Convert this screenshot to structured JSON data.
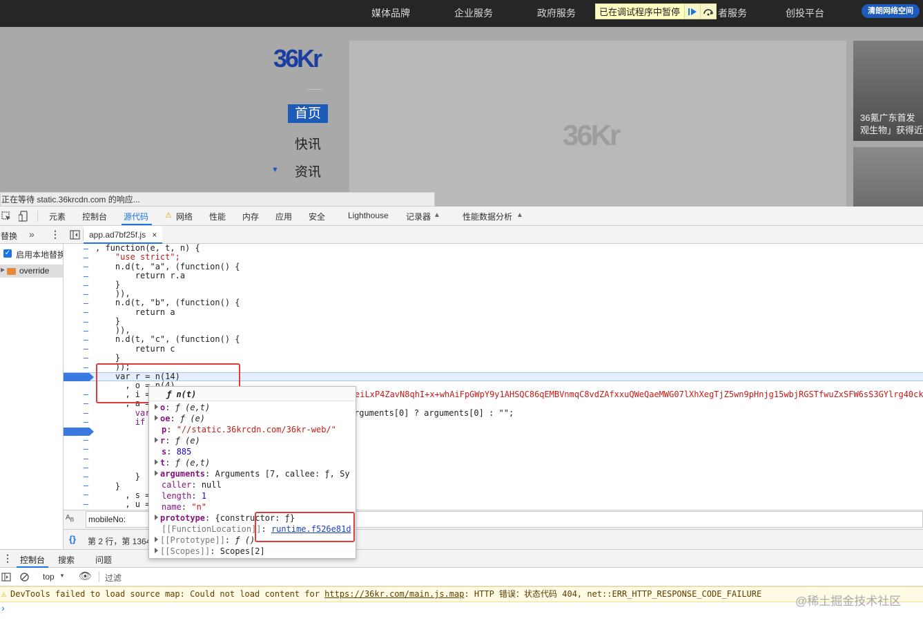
{
  "topnav": {
    "items": [
      "媒体品牌",
      "企业服务",
      "政府服务",
      "者服务",
      "创投平台"
    ],
    "paused_text": "已在调试程序中暂停",
    "brand_button": "清朗网络空间"
  },
  "page": {
    "logo": "36Kr",
    "nav_active": "首页",
    "nav_items": [
      "快讯",
      "资讯"
    ],
    "banner_logo": "36Kr",
    "side_card_lines": [
      "36氪广东首发",
      "观生物」获得近"
    ],
    "status_text": "正在等待 static.36krcdn.com 的响应..."
  },
  "devtools": {
    "tabs": [
      "元素",
      "控制台",
      "源代码",
      "网络",
      "性能",
      "内存",
      "应用",
      "安全",
      "Lighthouse",
      "记录器",
      "性能数据分析"
    ],
    "active_tab": "源代码",
    "left_panel": {
      "tab": "替换",
      "more": "»",
      "enable_label": "启用本地替换",
      "folder": "override"
    },
    "file_tab": "app.ad7bf25f.js",
    "code_lines": [
      ", function(e, t, n) {",
      "    \"use strict\";",
      "    n.d(t, \"a\", (function() {",
      "        return r.a",
      "    }",
      "    )),",
      "    n.d(t, \"b\", (function() {",
      "        return a",
      "    }",
      "    )),",
      "    n.d(t, \"c\", (function() {",
      "        return c",
      "    }",
      "    ));",
      "    var r = n(14)",
      "      , o = n(4)",
      "      , i =",
      "      , a =",
      "        var",
      "        if",
      "",
      "",
      "",
      "",
      "",
      "        }",
      "    }",
      "      , s =",
      "      , u ="
    ],
    "long_line_fragment": "eiLxP4ZavN8qhI+x+whAiFpGWpY9y1AHSQC86qEMBVnmqC8vdZAfxxuQWeQaeMWG07lXhXegTjZ5wn9pHnjg15wbjRGSTfwuZxSFW6sS3GYlrg40ck",
    "args_fragment": "rguments[0] ? arguments[0] : \"\";",
    "search_value": "mobileNo:",
    "status_line": "第 2 行，第 1364",
    "popover": {
      "title": "ƒ n(t)",
      "rows": [
        {
          "expand": true,
          "key": "o",
          "value": "ƒ (e,t)"
        },
        {
          "expand": true,
          "key": "oe",
          "value": "ƒ (e)"
        },
        {
          "expand": false,
          "key": "p",
          "value": "\"//static.36krcdn.com/36kr-web/\""
        },
        {
          "expand": true,
          "key": "r",
          "value": "ƒ (e)"
        },
        {
          "expand": false,
          "key": "s",
          "value": "885"
        },
        {
          "expand": true,
          "key": "t",
          "value": "ƒ (e,t)"
        },
        {
          "expand": true,
          "key": "arguments",
          "value": "Arguments [7, callee: ƒ, Sy"
        },
        {
          "expand": false,
          "key": "caller",
          "value": "null"
        },
        {
          "expand": false,
          "key": "length",
          "value": "1"
        },
        {
          "expand": false,
          "key": "name",
          "value": "\"n\""
        },
        {
          "expand": true,
          "key": "prototype",
          "value": "{constructor: ƒ}"
        },
        {
          "expand": false,
          "key": "[[FunctionLocation]]",
          "value": "runtime.f526e81d"
        },
        {
          "expand": true,
          "key": "[[Prototype]]",
          "value": "ƒ ()"
        },
        {
          "expand": true,
          "key": "[[Scopes]]",
          "value": "Scopes[2]"
        }
      ]
    },
    "drawer_tabs": [
      "控制台",
      "搜索",
      "问题"
    ],
    "console_context": "top",
    "filter_placeholder": "过滤",
    "warning": {
      "prefix": "DevTools failed to load source map: Could not load content for ",
      "link": "https://36kr.com/main.js.map",
      "suffix": ": HTTP 错误：状态代码 404, net::ERR_HTTP_RESPONSE_CODE_FAILURE"
    },
    "prompt": "›"
  },
  "watermark": "@稀土掘金技术社区",
  "colors": {
    "accent": "#1a73e8",
    "brand": "#1d5bb8",
    "highlight": "#e53935"
  }
}
